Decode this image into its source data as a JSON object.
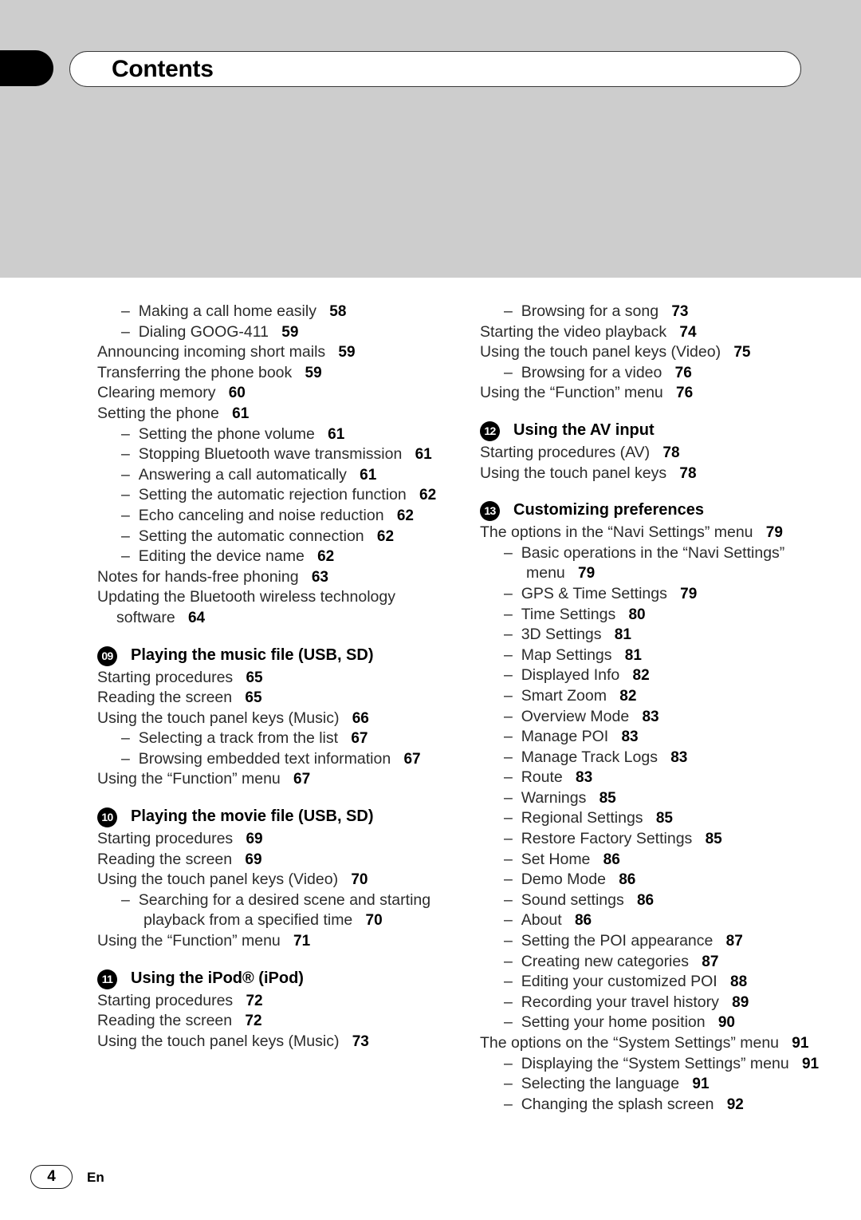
{
  "page": {
    "title": "Contents",
    "number": "4",
    "language": "En"
  },
  "left_column": [
    {
      "kind": "entry",
      "level": 2,
      "dash": "–",
      "label": "Making a call home easily",
      "page": "58"
    },
    {
      "kind": "entry",
      "level": 2,
      "dash": "–",
      "label": "Dialing GOOG-411",
      "page": "59"
    },
    {
      "kind": "entry",
      "level": 1,
      "label": "Announcing incoming short mails",
      "page": "59"
    },
    {
      "kind": "entry",
      "level": 1,
      "label": "Transferring the phone book",
      "page": "59"
    },
    {
      "kind": "entry",
      "level": 1,
      "label": "Clearing memory",
      "page": "60"
    },
    {
      "kind": "entry",
      "level": 1,
      "label": "Setting the phone",
      "page": "61"
    },
    {
      "kind": "entry",
      "level": 2,
      "dash": "–",
      "label": "Setting the phone volume",
      "page": "61"
    },
    {
      "kind": "entry",
      "level": 2,
      "dash": "–",
      "label": "Stopping Bluetooth wave transmission",
      "page": "61"
    },
    {
      "kind": "entry",
      "level": 2,
      "dash": "–",
      "label": "Answering a call automatically",
      "page": "61"
    },
    {
      "kind": "entry",
      "level": 2,
      "dash": "–",
      "label": "Setting the automatic rejection function",
      "page": "62"
    },
    {
      "kind": "entry",
      "level": 2,
      "dash": "–",
      "label": "Echo canceling and noise reduction",
      "page": "62"
    },
    {
      "kind": "entry",
      "level": 2,
      "dash": "–",
      "label": "Setting the automatic connection",
      "page": "62"
    },
    {
      "kind": "entry",
      "level": 2,
      "dash": "–",
      "label": "Editing the device name",
      "page": "62"
    },
    {
      "kind": "entry",
      "level": 1,
      "label": "Notes for hands-free phoning",
      "page": "63"
    },
    {
      "kind": "entry",
      "level": 1,
      "label": "Updating the Bluetooth wireless technology software",
      "page": "64"
    },
    {
      "kind": "section",
      "badge": "09",
      "title": "Playing the music file (USB, SD)"
    },
    {
      "kind": "entry",
      "level": 1,
      "label": "Starting procedures",
      "page": "65"
    },
    {
      "kind": "entry",
      "level": 1,
      "label": "Reading the screen",
      "page": "65"
    },
    {
      "kind": "entry",
      "level": 1,
      "label": "Using the touch panel keys (Music)",
      "page": "66"
    },
    {
      "kind": "entry",
      "level": 2,
      "dash": "–",
      "label": "Selecting a track from the list",
      "page": "67"
    },
    {
      "kind": "entry",
      "level": 2,
      "dash": "–",
      "label": "Browsing embedded text information",
      "page": "67"
    },
    {
      "kind": "entry",
      "level": 1,
      "label": "Using the “Function” menu",
      "page": "67"
    },
    {
      "kind": "section",
      "badge": "10",
      "title": "Playing the movie file (USB, SD)"
    },
    {
      "kind": "entry",
      "level": 1,
      "label": "Starting procedures",
      "page": "69"
    },
    {
      "kind": "entry",
      "level": 1,
      "label": "Reading the screen",
      "page": "69"
    },
    {
      "kind": "entry",
      "level": 1,
      "label": "Using the touch panel keys (Video)",
      "page": "70"
    },
    {
      "kind": "entry",
      "level": 2,
      "dash": "–",
      "label": "Searching for a desired scene and starting playback from a specified time",
      "page": "70"
    },
    {
      "kind": "entry",
      "level": 1,
      "label": "Using the “Function” menu",
      "page": "71"
    },
    {
      "kind": "section",
      "badge": "11",
      "title": "Using the iPod® (iPod)"
    },
    {
      "kind": "entry",
      "level": 1,
      "label": "Starting procedures",
      "page": "72"
    },
    {
      "kind": "entry",
      "level": 1,
      "label": "Reading the screen",
      "page": "72"
    },
    {
      "kind": "entry",
      "level": 1,
      "label": "Using the touch panel keys (Music)",
      "page": "73"
    }
  ],
  "right_column": [
    {
      "kind": "entry",
      "level": 2,
      "dash": "–",
      "label": "Browsing for a song",
      "page": "73"
    },
    {
      "kind": "entry",
      "level": 1,
      "label": "Starting the video playback",
      "page": "74"
    },
    {
      "kind": "entry",
      "level": 1,
      "label": "Using the touch panel keys (Video)",
      "page": "75"
    },
    {
      "kind": "entry",
      "level": 2,
      "dash": "–",
      "label": "Browsing for a video",
      "page": "76"
    },
    {
      "kind": "entry",
      "level": 1,
      "label": "Using the “Function” menu",
      "page": "76"
    },
    {
      "kind": "section",
      "badge": "12",
      "title": "Using the AV input"
    },
    {
      "kind": "entry",
      "level": 1,
      "label": "Starting procedures (AV)",
      "page": "78"
    },
    {
      "kind": "entry",
      "level": 1,
      "label": "Using the touch panel keys",
      "page": "78"
    },
    {
      "kind": "section",
      "badge": "13",
      "title": "Customizing preferences"
    },
    {
      "kind": "entry",
      "level": 1,
      "label": "The options in the “Navi Settings” menu",
      "page": "79"
    },
    {
      "kind": "entry",
      "level": 2,
      "dash": "–",
      "label": "Basic operations in the “Navi Settings” menu",
      "page": "79"
    },
    {
      "kind": "entry",
      "level": 2,
      "dash": "–",
      "label": "GPS & Time Settings",
      "page": "79"
    },
    {
      "kind": "entry",
      "level": 2,
      "dash": "–",
      "label": "Time Settings",
      "page": "80"
    },
    {
      "kind": "entry",
      "level": 2,
      "dash": "–",
      "label": "3D Settings",
      "page": "81"
    },
    {
      "kind": "entry",
      "level": 2,
      "dash": "–",
      "label": "Map Settings",
      "page": "81"
    },
    {
      "kind": "entry",
      "level": 2,
      "dash": "–",
      "label": "Displayed Info",
      "page": "82"
    },
    {
      "kind": "entry",
      "level": 2,
      "dash": "–",
      "label": "Smart Zoom",
      "page": "82"
    },
    {
      "kind": "entry",
      "level": 2,
      "dash": "–",
      "label": "Overview Mode",
      "page": "83"
    },
    {
      "kind": "entry",
      "level": 2,
      "dash": "–",
      "label": "Manage POI",
      "page": "83"
    },
    {
      "kind": "entry",
      "level": 2,
      "dash": "–",
      "label": "Manage Track Logs",
      "page": "83"
    },
    {
      "kind": "entry",
      "level": 2,
      "dash": "–",
      "label": "Route",
      "page": "83"
    },
    {
      "kind": "entry",
      "level": 2,
      "dash": "–",
      "label": "Warnings",
      "page": "85"
    },
    {
      "kind": "entry",
      "level": 2,
      "dash": "–",
      "label": "Regional Settings",
      "page": "85"
    },
    {
      "kind": "entry",
      "level": 2,
      "dash": "–",
      "label": "Restore Factory Settings",
      "page": "85"
    },
    {
      "kind": "entry",
      "level": 2,
      "dash": "–",
      "label": "Set Home",
      "page": "86"
    },
    {
      "kind": "entry",
      "level": 2,
      "dash": "–",
      "label": "Demo Mode",
      "page": "86"
    },
    {
      "kind": "entry",
      "level": 2,
      "dash": "–",
      "label": "Sound settings",
      "page": "86"
    },
    {
      "kind": "entry",
      "level": 2,
      "dash": "–",
      "label": "About",
      "page": "86"
    },
    {
      "kind": "entry",
      "level": 2,
      "dash": "–",
      "label": "Setting the POI appearance",
      "page": "87"
    },
    {
      "kind": "entry",
      "level": 2,
      "dash": "–",
      "label": "Creating new categories",
      "page": "87"
    },
    {
      "kind": "entry",
      "level": 2,
      "dash": "–",
      "label": "Editing your customized POI",
      "page": "88"
    },
    {
      "kind": "entry",
      "level": 2,
      "dash": "–",
      "label": "Recording your travel history",
      "page": "89"
    },
    {
      "kind": "entry",
      "level": 2,
      "dash": "–",
      "label": "Setting your home position",
      "page": "90"
    },
    {
      "kind": "entry",
      "level": 1,
      "label": "The options on the “System Settings” menu",
      "page": "91"
    },
    {
      "kind": "entry",
      "level": 2,
      "dash": "–",
      "label": "Displaying the “System Settings” menu",
      "page": "91"
    },
    {
      "kind": "entry",
      "level": 2,
      "dash": "–",
      "label": "Selecting the language",
      "page": "91"
    },
    {
      "kind": "entry",
      "level": 2,
      "dash": "–",
      "label": "Changing the splash screen",
      "page": "92"
    }
  ]
}
